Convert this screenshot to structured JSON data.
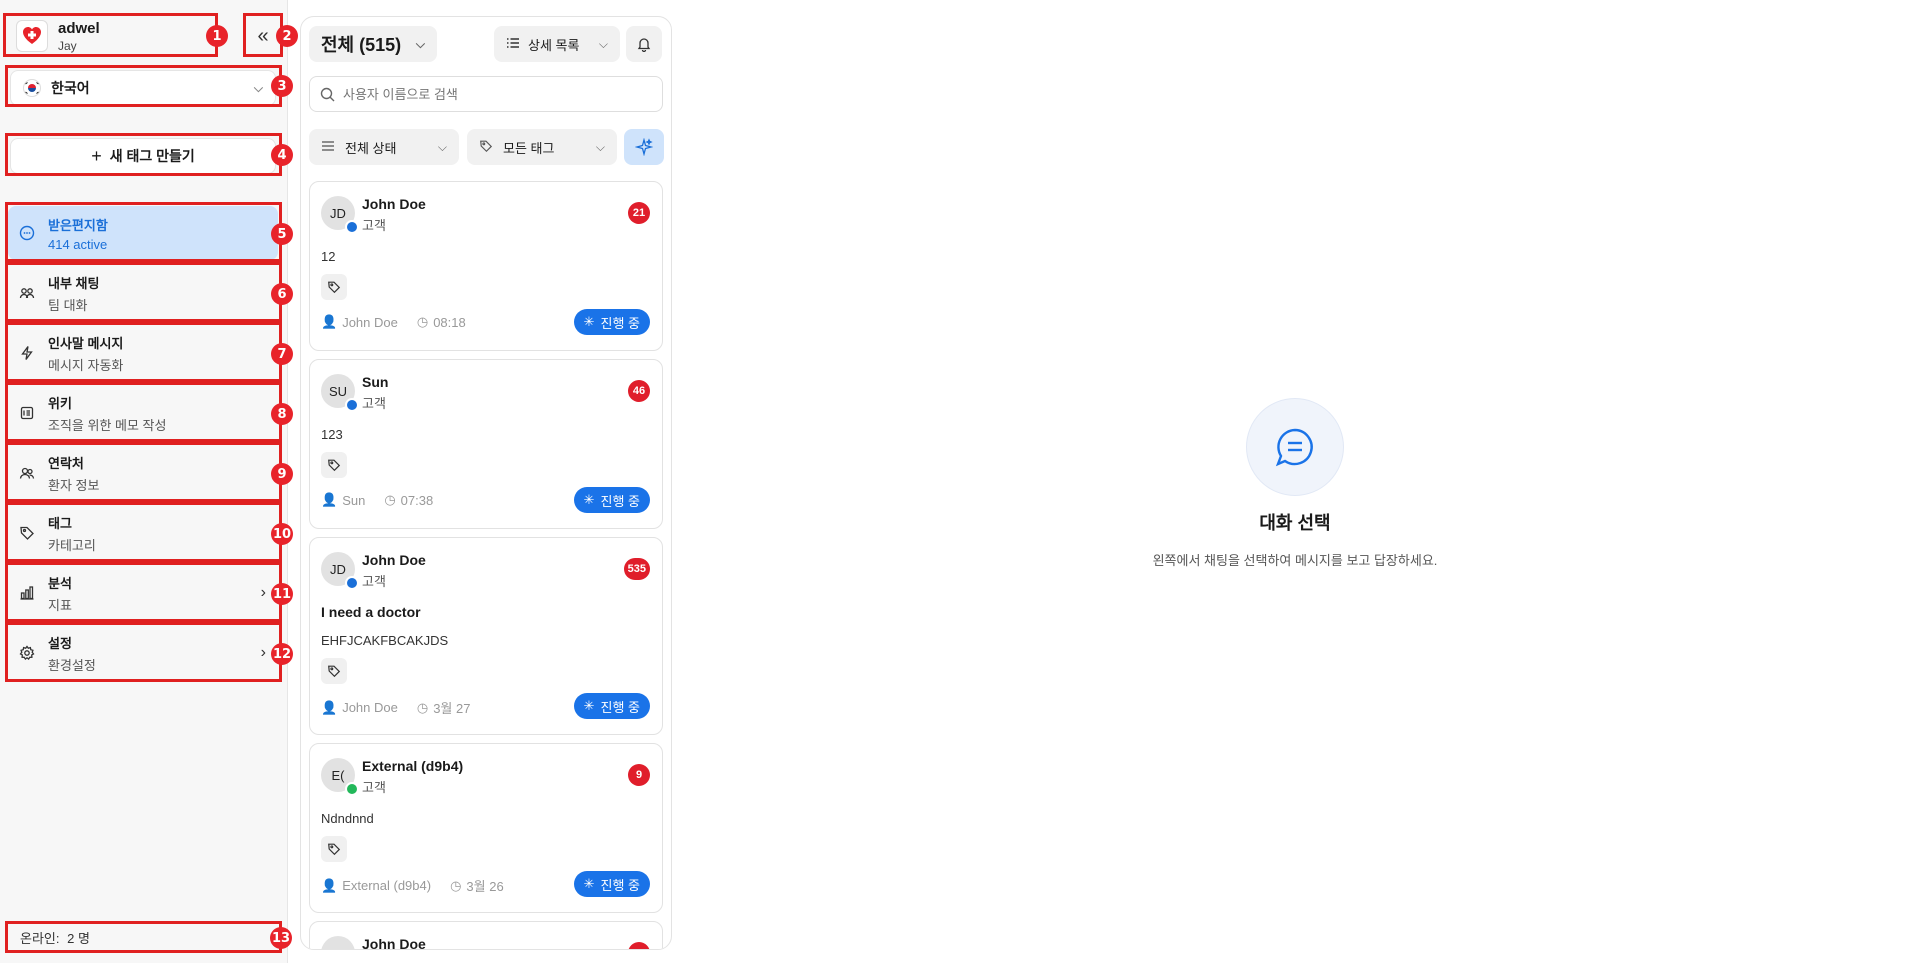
{
  "workspace": {
    "name": "adwel",
    "user": "Jay"
  },
  "language": {
    "selected": "한국어"
  },
  "new_tag_button": "새 태그 만들기",
  "nav": [
    {
      "title": "받은편지함",
      "subtitle": "414 active"
    },
    {
      "title": "내부 채팅",
      "subtitle": "팀 대화"
    },
    {
      "title": "인사말 메시지",
      "subtitle": "메시지 자동화"
    },
    {
      "title": "위키",
      "subtitle": "조직을 위한 메모 작성"
    },
    {
      "title": "연락처",
      "subtitle": "환자 정보"
    },
    {
      "title": "태그",
      "subtitle": "카테고리"
    },
    {
      "title": "분석",
      "subtitle": "지표"
    },
    {
      "title": "설정",
      "subtitle": "환경설정"
    }
  ],
  "online": {
    "label": "온라인:",
    "count": "2 명"
  },
  "list": {
    "filter_label": "전체 (515)",
    "view_label": "상세 목록",
    "search_placeholder": "사용자 이름으로 검색",
    "status_filter": "전체 상태",
    "tag_filter": "모든 태그"
  },
  "conversations": [
    {
      "initials": "JD",
      "name": "John Doe",
      "role": "고객",
      "unread": "21",
      "subject": "",
      "message": "12",
      "agent": "John Doe",
      "time": "08:18",
      "status": "진행 중",
      "channel": "chat"
    },
    {
      "initials": "SU",
      "name": "Sun",
      "role": "고객",
      "unread": "46",
      "subject": "",
      "message": "123",
      "agent": "Sun",
      "time": "07:38",
      "status": "진행 중",
      "channel": "chat"
    },
    {
      "initials": "JD",
      "name": "John Doe",
      "role": "고객",
      "unread": "535",
      "subject": "I need a doctor",
      "message": "EHFJCAKFBCAKJDS",
      "agent": "John Doe",
      "time": "3월 27",
      "status": "진행 중",
      "channel": "chat"
    },
    {
      "initials": "E(",
      "name": "External (d9b4)",
      "role": "고객",
      "unread": "9",
      "subject": "",
      "message": "Ndndnnd",
      "agent": "External (d9b4)",
      "time": "3월 26",
      "status": "진행 중",
      "channel": "line"
    },
    {
      "initials": "JD",
      "name": "John Doe",
      "role": "",
      "unread": "",
      "subject": "",
      "message": "",
      "agent": "",
      "time": "",
      "status": "",
      "channel": "chat"
    }
  ],
  "empty_state": {
    "title": "대화 선택",
    "description": "왼쪽에서 채팅을 선택하여 메시지를 보고 답장하세요."
  },
  "annotations": [
    "1",
    "2",
    "3",
    "4",
    "5",
    "6",
    "7",
    "8",
    "9",
    "10",
    "11",
    "12",
    "13"
  ],
  "colors": {
    "accent": "#1a73e8",
    "active_bg": "#cfe3fb",
    "unread": "#e01e2b",
    "annotation": "#e02020"
  }
}
